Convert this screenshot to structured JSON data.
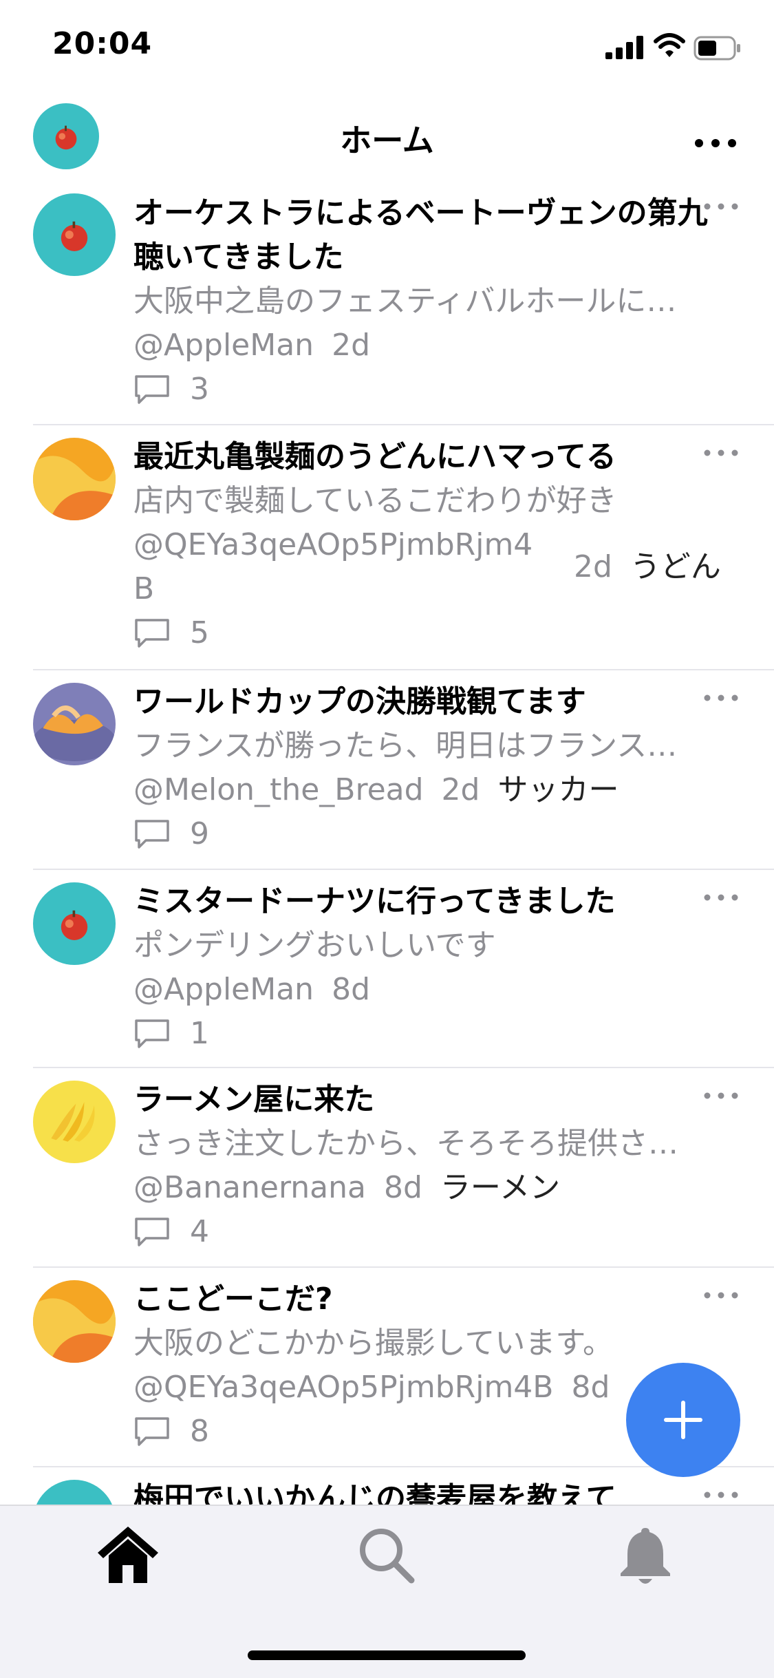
{
  "status_bar": {
    "time": "20:04"
  },
  "header": {
    "title": "ホーム",
    "more_icon": "ellipsis-icon",
    "avatar": "apple-avatar"
  },
  "posts": [
    {
      "avatar": "apple",
      "title": "オーケストラによるベートーヴェンの第九聴いてきました",
      "body": "大阪中之島のフェスティバルホールに…",
      "handle": "@AppleMan",
      "date": "2d",
      "tag": "",
      "comments": "3"
    },
    {
      "avatar": "orange",
      "title": "最近丸亀製麺のうどんにハマってる",
      "body": "店内で製麺しているこだわりが好き",
      "handle": "@QEYa3qeAOp5PjmbRjm4",
      "handle_cont": "B",
      "date": "2d",
      "tag": "うどん",
      "comments": "5"
    },
    {
      "avatar": "melon",
      "title": "ワールドカップの決勝戦観てます",
      "body": "フランスが勝ったら、明日はフランス…",
      "handle": "@Melon_the_Bread",
      "date": "2d",
      "tag": "サッカー",
      "comments": "9"
    },
    {
      "avatar": "apple",
      "title": "ミスタードーナツに行ってきました",
      "body": "ポンデリングおいしいです",
      "handle": "@AppleMan",
      "date": "8d",
      "tag": "",
      "comments": "1"
    },
    {
      "avatar": "banana",
      "title": "ラーメン屋に来た",
      "body": "さっき注文したから、そろそろ提供さ…",
      "handle": "@Bananernana",
      "date": "8d",
      "tag": "ラーメン",
      "comments": "4"
    },
    {
      "avatar": "orange",
      "title": "ここどーこだ?",
      "body": "大阪のどこかから撮影しています。",
      "handle": "@QEYa3qeAOp5PjmbRjm4B",
      "date": "8d",
      "tag": "",
      "comments": "8"
    },
    {
      "avatar": "apple",
      "title": "梅田でいいかんじの蕎麦屋を教えて",
      "body": "",
      "handle": "",
      "date": "",
      "tag": "",
      "comments": ""
    }
  ],
  "fab": {
    "icon": "plus-icon"
  },
  "tabbar": {
    "items": [
      {
        "name": "home",
        "icon": "home-icon",
        "active": true
      },
      {
        "name": "search",
        "icon": "search-icon",
        "active": false
      },
      {
        "name": "notifications",
        "icon": "bell-icon",
        "active": false
      }
    ]
  },
  "colors": {
    "accent": "#3d82f1",
    "secondary_text": "#8e8e93",
    "separator": "#e5e5ea"
  }
}
